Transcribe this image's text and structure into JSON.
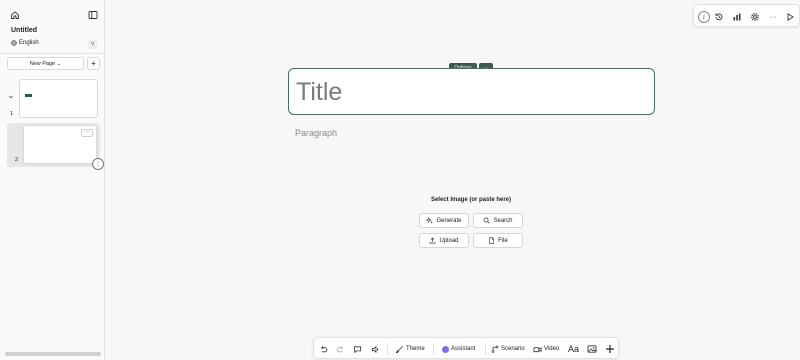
{
  "sidebar": {
    "doc_title": "Untitled",
    "language": "English",
    "help_label": "?",
    "new_page_label": "New Page ⌄",
    "add_label": "+",
    "slides": [
      {
        "number": "1"
      },
      {
        "number": "2",
        "menu": "···"
      }
    ],
    "resize_label": "⋮"
  },
  "topbar": {
    "info_label": "i",
    "more_label": "···"
  },
  "canvas": {
    "options_label": "Options",
    "options_more": "···",
    "title_placeholder": "Title",
    "paragraph_placeholder": "Paragraph"
  },
  "image_picker": {
    "label": "Select Image (or paste here)",
    "buttons": {
      "generate": "Generate",
      "search": "Search",
      "upload": "Upload",
      "file": "File"
    }
  },
  "bottombar": {
    "theme": "Theme",
    "assistant": "Assistant",
    "scenario": "Scenario",
    "video": "Video",
    "font": "Aa"
  },
  "colors": {
    "accent": "#3b5a52",
    "assistant_dot": "#7c6ee6"
  }
}
